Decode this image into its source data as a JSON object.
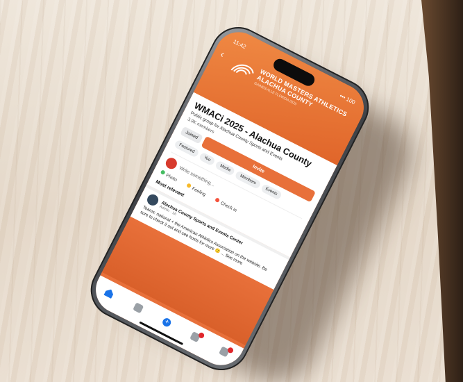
{
  "scene": {
    "subject": "smartphone-on-marble-counter",
    "accent_color": "#e8703a",
    "surface_color": "#e9dfd3"
  },
  "status_bar": {
    "time": "11:42",
    "right": "••• 100"
  },
  "cover": {
    "logo_line1": "WORLD MASTERS ATHLETICS",
    "logo_line2": "ALACHUA COUNTY",
    "logo_sub": "GAINESVILLE FLORIDA 2025"
  },
  "group": {
    "title": "WMACi 2025 - Alachua County",
    "description": "Public group for Alachua County Sports and Events",
    "members": "3.9K members",
    "joined_label": "Joined",
    "invite_label": "Invite",
    "tabs": [
      "Featured",
      "You",
      "Media",
      "Members",
      "Events"
    ]
  },
  "composer": {
    "placeholder": "Write something...",
    "actions": [
      "Photo",
      "Feeling",
      "Check in"
    ]
  },
  "feed": {
    "section_label": "Most relevant",
    "post_author": "Alachua County Sports and Events Center",
    "post_meta": "Admin · 1h",
    "post_text": "Teams: national + the American Athletics Association on the website. Be sure to check it out and see hosts for more 🙂 ... See more"
  },
  "icons": [
    "home-icon",
    "video-icon",
    "plus-icon",
    "bell-icon",
    "menu-icon"
  ]
}
